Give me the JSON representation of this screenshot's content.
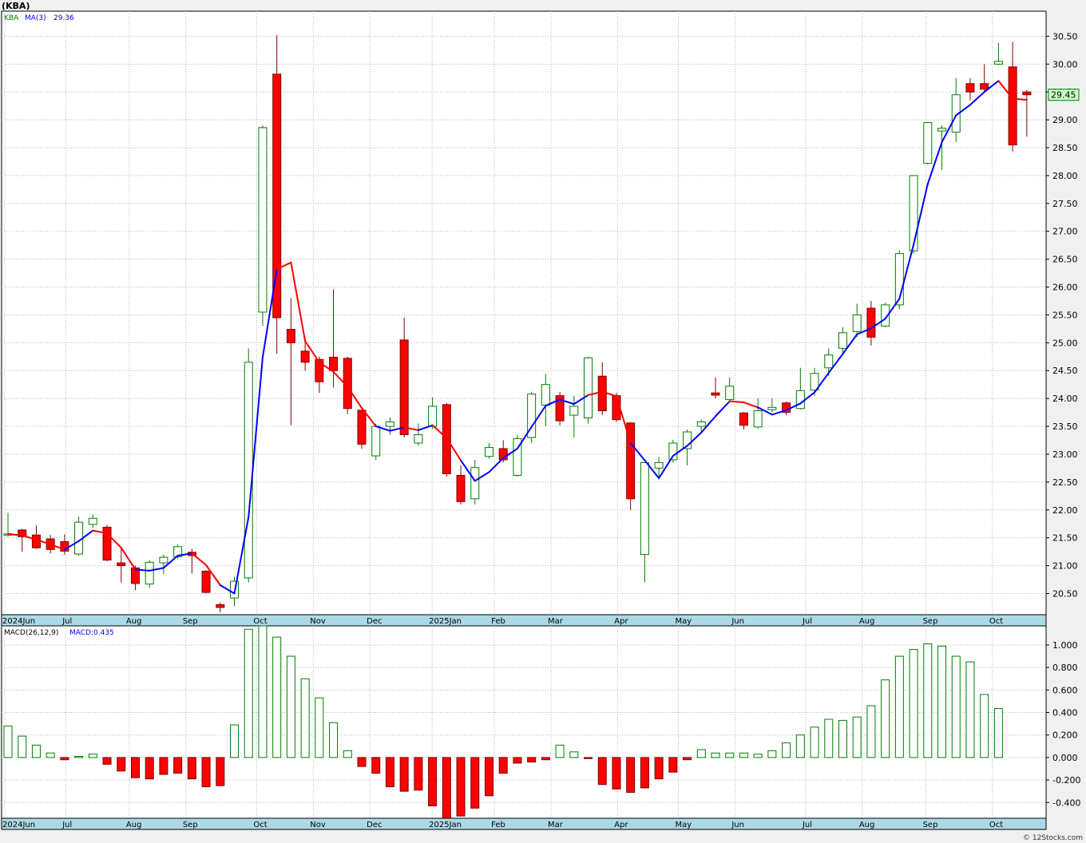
{
  "chart_data": [
    {
      "type": "candlestick",
      "ticker_label": "(KBA)",
      "legend": {
        "symbol": "KBA",
        "ma_label": "MA(3)",
        "ma_value": "29.36",
        "symbol_color": "#008000",
        "ma_label_color": "#0000ff"
      },
      "last_price_label": "29.45",
      "y_ticks": [
        "20.50",
        "21.00",
        "21.50",
        "22.00",
        "22.50",
        "23.00",
        "23.50",
        "24.00",
        "24.50",
        "25.00",
        "25.50",
        "26.00",
        "26.50",
        "27.00",
        "27.50",
        "28.00",
        "28.50",
        "29.00",
        "29.50",
        "30.00",
        "30.50"
      ],
      "ylim": [
        20.12,
        30.95
      ],
      "x_labels": [
        "2024Jun",
        "Jul",
        "Aug",
        "Sep",
        "Oct",
        "Nov",
        "Dec",
        "2025Jan",
        "Feb",
        "Mar",
        "Apr",
        "May",
        "Jun",
        "Jul",
        "Aug",
        "Sep",
        "Oct"
      ],
      "x_label_index": [
        0,
        4.3,
        8.8,
        12.8,
        17.8,
        21.8,
        25.8,
        30.2,
        34.6,
        38.6,
        43.3,
        47.6,
        51.6,
        56.6,
        60.6,
        65.1,
        69.8
      ],
      "colors": {
        "up": "#ffffff",
        "up_border": "#008000",
        "down": "#ff0000",
        "down_border": "#800000",
        "ma_up": "#0000ff",
        "ma_down": "#ff0000"
      },
      "candles": [
        {
          "o": 21.55,
          "h": 21.95,
          "l": 21.52,
          "c": 21.57
        },
        {
          "o": 21.64,
          "h": 21.66,
          "l": 21.25,
          "c": 21.52
        },
        {
          "o": 21.55,
          "h": 21.72,
          "l": 21.3,
          "c": 21.32
        },
        {
          "o": 21.48,
          "h": 21.55,
          "l": 21.22,
          "c": 21.29
        },
        {
          "o": 21.43,
          "h": 21.56,
          "l": 21.2,
          "c": 21.26
        },
        {
          "o": 21.21,
          "h": 21.88,
          "l": 21.18,
          "c": 21.78
        },
        {
          "o": 21.74,
          "h": 21.92,
          "l": 21.68,
          "c": 21.85
        },
        {
          "o": 21.69,
          "h": 21.73,
          "l": 21.08,
          "c": 21.1
        },
        {
          "o": 21.05,
          "h": 21.3,
          "l": 20.7,
          "c": 21.0
        },
        {
          "o": 20.96,
          "h": 21.0,
          "l": 20.56,
          "c": 20.68
        },
        {
          "o": 20.67,
          "h": 21.1,
          "l": 20.6,
          "c": 21.06
        },
        {
          "o": 21.05,
          "h": 21.2,
          "l": 20.85,
          "c": 21.15
        },
        {
          "o": 21.16,
          "h": 21.38,
          "l": 21.12,
          "c": 21.34
        },
        {
          "o": 21.24,
          "h": 21.3,
          "l": 20.86,
          "c": 21.18
        },
        {
          "o": 20.9,
          "h": 20.92,
          "l": 20.5,
          "c": 20.52
        },
        {
          "o": 20.3,
          "h": 20.34,
          "l": 20.16,
          "c": 20.25
        },
        {
          "o": 20.42,
          "h": 20.8,
          "l": 20.27,
          "c": 20.72
        },
        {
          "o": 20.78,
          "h": 24.9,
          "l": 20.7,
          "c": 24.65
        },
        {
          "o": 25.55,
          "h": 28.9,
          "l": 25.3,
          "c": 28.86
        },
        {
          "o": 29.82,
          "h": 30.52,
          "l": 24.8,
          "c": 25.45
        },
        {
          "o": 25.24,
          "h": 25.8,
          "l": 23.52,
          "c": 25.0
        },
        {
          "o": 24.85,
          "h": 25.1,
          "l": 24.5,
          "c": 24.65
        },
        {
          "o": 24.7,
          "h": 24.75,
          "l": 24.1,
          "c": 24.3
        },
        {
          "o": 24.74,
          "h": 25.96,
          "l": 24.2,
          "c": 24.5
        },
        {
          "o": 24.72,
          "h": 24.75,
          "l": 23.72,
          "c": 23.82
        },
        {
          "o": 23.79,
          "h": 23.8,
          "l": 23.1,
          "c": 23.18
        },
        {
          "o": 22.97,
          "h": 23.55,
          "l": 22.9,
          "c": 23.5
        },
        {
          "o": 23.5,
          "h": 23.66,
          "l": 23.35,
          "c": 23.58
        },
        {
          "o": 25.05,
          "h": 25.45,
          "l": 23.3,
          "c": 23.35
        },
        {
          "o": 23.2,
          "h": 23.55,
          "l": 23.15,
          "c": 23.35
        },
        {
          "o": 23.5,
          "h": 24.02,
          "l": 23.45,
          "c": 23.86
        },
        {
          "o": 23.89,
          "h": 23.92,
          "l": 22.6,
          "c": 22.65
        },
        {
          "o": 22.62,
          "h": 22.8,
          "l": 22.1,
          "c": 22.15
        },
        {
          "o": 22.2,
          "h": 22.9,
          "l": 22.1,
          "c": 22.76
        },
        {
          "o": 22.96,
          "h": 23.2,
          "l": 22.92,
          "c": 23.12
        },
        {
          "o": 23.1,
          "h": 23.25,
          "l": 22.85,
          "c": 22.9
        },
        {
          "o": 22.62,
          "h": 23.35,
          "l": 22.6,
          "c": 23.28
        },
        {
          "o": 23.3,
          "h": 24.12,
          "l": 23.2,
          "c": 24.08
        },
        {
          "o": 23.88,
          "h": 24.44,
          "l": 23.5,
          "c": 24.25
        },
        {
          "o": 24.05,
          "h": 24.12,
          "l": 23.52,
          "c": 23.6
        },
        {
          "o": 23.7,
          "h": 24.05,
          "l": 23.3,
          "c": 23.86
        },
        {
          "o": 23.65,
          "h": 24.75,
          "l": 23.55,
          "c": 24.73
        },
        {
          "o": 24.4,
          "h": 24.65,
          "l": 23.7,
          "c": 23.78
        },
        {
          "o": 24.05,
          "h": 24.1,
          "l": 23.58,
          "c": 23.62
        },
        {
          "o": 23.56,
          "h": 23.58,
          "l": 22.0,
          "c": 22.2
        },
        {
          "o": 21.2,
          "h": 22.8,
          "l": 20.7,
          "c": 22.85
        },
        {
          "o": 22.75,
          "h": 22.95,
          "l": 22.55,
          "c": 22.85
        },
        {
          "o": 22.9,
          "h": 23.26,
          "l": 22.85,
          "c": 23.2
        },
        {
          "o": 23.1,
          "h": 23.44,
          "l": 22.8,
          "c": 23.4
        },
        {
          "o": 23.5,
          "h": 23.62,
          "l": 23.4,
          "c": 23.58
        },
        {
          "o": 24.1,
          "h": 24.38,
          "l": 24.0,
          "c": 24.06
        },
        {
          "o": 23.98,
          "h": 24.38,
          "l": 23.95,
          "c": 24.22
        },
        {
          "o": 23.74,
          "h": 23.76,
          "l": 23.44,
          "c": 23.52
        },
        {
          "o": 23.49,
          "h": 24.0,
          "l": 23.46,
          "c": 23.78
        },
        {
          "o": 23.8,
          "h": 24.0,
          "l": 23.75,
          "c": 23.84
        },
        {
          "o": 23.92,
          "h": 23.95,
          "l": 23.7,
          "c": 23.75
        },
        {
          "o": 23.82,
          "h": 24.55,
          "l": 23.8,
          "c": 24.14
        },
        {
          "o": 24.15,
          "h": 24.55,
          "l": 24.05,
          "c": 24.45
        },
        {
          "o": 24.55,
          "h": 24.9,
          "l": 24.4,
          "c": 24.78
        },
        {
          "o": 24.9,
          "h": 25.28,
          "l": 24.8,
          "c": 25.18
        },
        {
          "o": 25.2,
          "h": 25.7,
          "l": 25.1,
          "c": 25.5
        },
        {
          "o": 25.62,
          "h": 25.75,
          "l": 24.95,
          "c": 25.1
        },
        {
          "o": 25.3,
          "h": 25.72,
          "l": 25.28,
          "c": 25.68
        },
        {
          "o": 25.68,
          "h": 26.66,
          "l": 25.6,
          "c": 26.6
        },
        {
          "o": 26.65,
          "h": 28.0,
          "l": 26.6,
          "c": 28.0
        },
        {
          "o": 28.22,
          "h": 28.96,
          "l": 28.2,
          "c": 28.95
        },
        {
          "o": 28.8,
          "h": 28.9,
          "l": 28.1,
          "c": 28.85
        },
        {
          "o": 28.78,
          "h": 29.75,
          "l": 28.6,
          "c": 29.45
        },
        {
          "o": 29.65,
          "h": 29.75,
          "l": 29.35,
          "c": 29.5
        },
        {
          "o": 29.65,
          "h": 30.0,
          "l": 29.5,
          "c": 29.55
        },
        {
          "o": 30.0,
          "h": 30.38,
          "l": 29.98,
          "c": 30.05
        },
        {
          "o": 29.95,
          "h": 30.4,
          "l": 28.43,
          "c": 28.55
        },
        {
          "o": 29.5,
          "h": 29.54,
          "l": 28.7,
          "c": 29.45
        }
      ],
      "ma": [
        21.57,
        21.54,
        21.47,
        21.38,
        21.29,
        21.44,
        21.63,
        21.58,
        21.32,
        20.93,
        20.91,
        20.96,
        21.18,
        21.22,
        21.01,
        20.65,
        20.5,
        21.87,
        24.74,
        26.32,
        26.44,
        25.03,
        24.65,
        24.48,
        24.21,
        23.83,
        23.5,
        23.42,
        23.48,
        23.43,
        23.52,
        23.29,
        22.89,
        22.52,
        22.68,
        22.93,
        23.1,
        23.49,
        23.87,
        23.98,
        23.9,
        24.06,
        24.12,
        24.04,
        23.2,
        22.89,
        22.57,
        22.97,
        23.15,
        23.39,
        23.68,
        23.95,
        23.93,
        23.84,
        23.71,
        23.79,
        23.91,
        24.11,
        24.46,
        24.8,
        25.15,
        25.26,
        25.43,
        25.79,
        26.76,
        27.85,
        28.6,
        29.08,
        29.27,
        29.5,
        29.7,
        29.38,
        29.36
      ],
      "ma_dir": [
        "u",
        "d",
        "d",
        "d",
        "d",
        "u",
        "u",
        "d",
        "d",
        "d",
        "u",
        "u",
        "u",
        "u",
        "d",
        "d",
        "u",
        "u",
        "u",
        "u",
        "d",
        "d",
        "d",
        "d",
        "d",
        "d",
        "d",
        "u",
        "u",
        "d",
        "u",
        "d",
        "d",
        "u",
        "u",
        "u",
        "u",
        "u",
        "u",
        "u",
        "u",
        "u",
        "d",
        "d",
        "d",
        "u",
        "u",
        "u",
        "u",
        "u",
        "u",
        "u",
        "d",
        "d",
        "u",
        "u",
        "u",
        "u",
        "u",
        "u",
        "u",
        "u",
        "u",
        "u",
        "u",
        "u",
        "u",
        "u",
        "u",
        "u",
        "u",
        "d",
        "d"
      ]
    },
    {
      "type": "bar",
      "title": "MACD(26,12,9)",
      "value_label": "MACD:0.435",
      "title_color": "#000000",
      "value_color": "#0000ff",
      "y_ticks": [
        "-0.400",
        "-0.200",
        "0.000",
        "0.200",
        "0.400",
        "0.600",
        "0.800",
        "1.000"
      ],
      "ylim": [
        -0.54,
        1.17
      ],
      "values": [
        0.28,
        0.19,
        0.11,
        0.04,
        -0.02,
        0.01,
        0.03,
        -0.06,
        -0.12,
        -0.18,
        -0.19,
        -0.15,
        -0.14,
        -0.19,
        -0.26,
        -0.25,
        0.29,
        1.14,
        1.17,
        1.07,
        0.9,
        0.7,
        0.53,
        0.31,
        0.06,
        -0.08,
        -0.14,
        -0.26,
        -0.3,
        -0.29,
        -0.43,
        -0.54,
        -0.52,
        -0.45,
        -0.34,
        -0.14,
        -0.05,
        -0.04,
        -0.02,
        0.11,
        0.05,
        -0.01,
        -0.24,
        -0.28,
        -0.31,
        -0.27,
        -0.19,
        -0.13,
        -0.02,
        0.07,
        0.04,
        0.04,
        0.04,
        0.03,
        0.06,
        0.13,
        0.2,
        0.27,
        0.34,
        0.33,
        0.36,
        0.46,
        0.69,
        0.9,
        0.96,
        1.01,
        0.99,
        0.9,
        0.85,
        0.56,
        0.435
      ]
    }
  ],
  "watermark": "© 12Stocks.com"
}
